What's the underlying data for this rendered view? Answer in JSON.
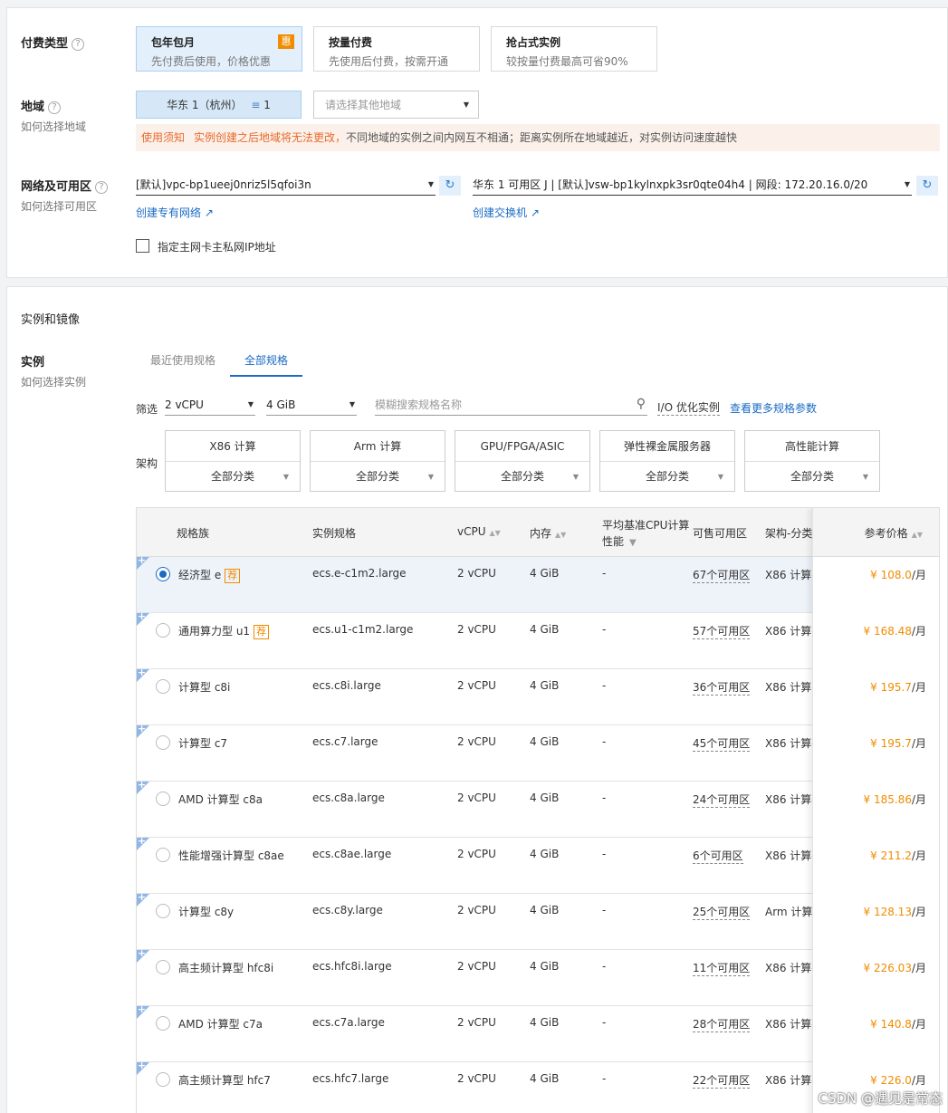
{
  "billing": {
    "title": "付费类型",
    "options": [
      {
        "title": "包年包月",
        "desc": "先付费后使用，价格优惠",
        "badge": "惠"
      },
      {
        "title": "按量付费",
        "desc": "先使用后付费，按需开通"
      },
      {
        "title": "抢占式实例",
        "desc": "较按量付费最高可省90%"
      }
    ]
  },
  "region": {
    "title": "地域",
    "sub": "如何选择地域",
    "selected": "华东 1（杭州）",
    "selected_count": "1",
    "other_placeholder": "请选择其他地域",
    "notice_tag": "使用须知",
    "notice_warn": "实例创建之后地域将无法更改，",
    "notice_text": "不同地域的实例之间内网互不相通；距离实例所在地域越近，对实例访问速度越快"
  },
  "network": {
    "title": "网络及可用区",
    "sub": "如何选择可用区",
    "vpc_value": "[默认]vpc-bp1ueej0nriz5l5qfoi3n",
    "vsw_value": "华东 1 可用区 J | [默认]vsw-bp1kylnxpk3sr0qte04h4 | 网段: 172.20.16.0/20",
    "create_vpc": "创建专有网络",
    "create_vsw": "创建交换机",
    "private_ip_label": "指定主网卡主私网IP地址"
  },
  "instance_section": {
    "heading": "实例和镜像",
    "title": "实例",
    "sub": "如何选择实例",
    "tabs": [
      "最近使用规格",
      "全部规格"
    ],
    "filter_label": "筛选",
    "cpu_filter": "2 vCPU",
    "mem_filter": "4 GiB",
    "search_placeholder": "模糊搜索规格名称",
    "io_label": "I/O 优化实例",
    "more_params": "查看更多规格参数",
    "arch_label": "架构",
    "arch": [
      {
        "name": "X86 计算",
        "filter": "全部分类"
      },
      {
        "name": "Arm 计算",
        "filter": "全部分类"
      },
      {
        "name": "GPU/FPGA/ASIC",
        "filter": "全部分类"
      },
      {
        "name": "弹性裸金属服务器",
        "filter": "全部分类"
      },
      {
        "name": "高性能计算",
        "filter": "全部分类"
      }
    ]
  },
  "table": {
    "headers": {
      "family": "规格族",
      "spec": "实例规格",
      "vcpu": "vCPU",
      "mem": "内存",
      "baseline_1": "平均基准CPU计算",
      "baseline_2": "性能",
      "zones": "可售可用区",
      "arch": "架构-分类",
      "price": "参考价格"
    },
    "rec_label": "荐",
    "rows": [
      {
        "family": "经济型 e",
        "rec": true,
        "spec": "ecs.e-c1m2.large",
        "vcpu": "2 vCPU",
        "mem": "4 GiB",
        "baseline": "-",
        "zones": "67个可用区",
        "arch": "X86 计算-",
        "price": "¥ 108.0",
        "unit": "/月",
        "selected": true
      },
      {
        "family": "通用算力型 u1",
        "rec": true,
        "spec": "ecs.u1-c1m2.large",
        "vcpu": "2 vCPU",
        "mem": "4 GiB",
        "baseline": "-",
        "zones": "57个可用区",
        "arch": "X86 计算-",
        "price": "¥ 168.48",
        "unit": "/月"
      },
      {
        "family": "计算型 c8i",
        "spec": "ecs.c8i.large",
        "vcpu": "2 vCPU",
        "mem": "4 GiB",
        "baseline": "-",
        "zones": "36个可用区",
        "arch": "X86 计算-",
        "price": "¥ 195.7",
        "unit": "/月"
      },
      {
        "family": "计算型 c7",
        "spec": "ecs.c7.large",
        "vcpu": "2 vCPU",
        "mem": "4 GiB",
        "baseline": "-",
        "zones": "45个可用区",
        "arch": "X86 计算-",
        "price": "¥ 195.7",
        "unit": "/月"
      },
      {
        "family": "AMD 计算型 c8a",
        "spec": "ecs.c8a.large",
        "vcpu": "2 vCPU",
        "mem": "4 GiB",
        "baseline": "-",
        "zones": "24个可用区",
        "arch": "X86 计算-",
        "price": "¥ 185.86",
        "unit": "/月"
      },
      {
        "family": "性能增强计算型 c8ae",
        "spec": "ecs.c8ae.large",
        "vcpu": "2 vCPU",
        "mem": "4 GiB",
        "baseline": "-",
        "zones": "6个可用区",
        "arch": "X86 计算-",
        "price": "¥ 211.2",
        "unit": "/月"
      },
      {
        "family": "计算型 c8y",
        "spec": "ecs.c8y.large",
        "vcpu": "2 vCPU",
        "mem": "4 GiB",
        "baseline": "-",
        "zones": "25个可用区",
        "arch": "Arm 计算-",
        "price": "¥ 128.13",
        "unit": "/月"
      },
      {
        "family": "高主频计算型 hfc8i",
        "spec": "ecs.hfc8i.large",
        "vcpu": "2 vCPU",
        "mem": "4 GiB",
        "baseline": "-",
        "zones": "11个可用区",
        "arch": "X86 计算-",
        "price": "¥ 226.03",
        "unit": "/月"
      },
      {
        "family": "AMD 计算型 c7a",
        "spec": "ecs.c7a.large",
        "vcpu": "2 vCPU",
        "mem": "4 GiB",
        "baseline": "-",
        "zones": "28个可用区",
        "arch": "X86 计算-",
        "price": "¥ 140.8",
        "unit": "/月"
      },
      {
        "family": "高主频计算型 hfc7",
        "spec": "ecs.hfc7.large",
        "vcpu": "2 vCPU",
        "mem": "4 GiB",
        "baseline": "-",
        "zones": "22个可用区",
        "arch": "X86 计算-",
        "price": "¥ 226.0",
        "unit": "/月"
      }
    ]
  },
  "watermark": "CSDN @遇见是常态"
}
